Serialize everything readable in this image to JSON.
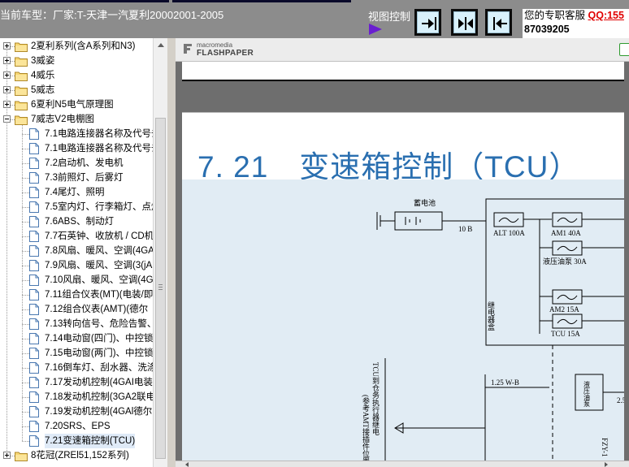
{
  "header": {
    "current_car": "当前车型：厂家:T-天津一汽夏利20002001-2005",
    "view_control_label": "视图控制",
    "support_label": "您的专职客服",
    "qq_label": "QQ:155",
    "phone_partial": "87039205"
  },
  "tree": {
    "items": [
      {
        "label": "2夏利系列(含A系列和N3)",
        "type": "folder",
        "expanded": false
      },
      {
        "label": "3威姿",
        "type": "folder",
        "expanded": false
      },
      {
        "label": "4威乐",
        "type": "folder",
        "expanded": false
      },
      {
        "label": "5威志",
        "type": "folder",
        "expanded": false
      },
      {
        "label": "6夏利N5电气原理图",
        "type": "folder",
        "expanded": false
      },
      {
        "label": "7威志V2电棚图",
        "type": "folder",
        "expanded": true
      },
      {
        "label": "7.1电路连接器名称及代号去",
        "type": "doc"
      },
      {
        "label": "7.1电路连接器名称及代号去",
        "type": "doc"
      },
      {
        "label": "7.2启动机、发电机",
        "type": "doc"
      },
      {
        "label": "7.3前照灯、后雾灯",
        "type": "doc"
      },
      {
        "label": "7.4尾灯、照明",
        "type": "doc"
      },
      {
        "label": "7.5室内灯、行李箱灯、点烟",
        "type": "doc"
      },
      {
        "label": "7.6ABS、制动灯",
        "type": "doc"
      },
      {
        "label": "7.7石英钟、收放机 / CD机",
        "type": "doc"
      },
      {
        "label": "7.8风扇、暖风、空调(4GA",
        "type": "doc"
      },
      {
        "label": "7.9风扇、暖风、空调(3(jA",
        "type": "doc"
      },
      {
        "label": "7.10风扇、暖风、空调(4G",
        "type": "doc"
      },
      {
        "label": "7.11组合仪表(MT)(电装/即",
        "type": "doc"
      },
      {
        "label": "7.12组合仪表(AMT)(德尔",
        "type": "doc"
      },
      {
        "label": "7.13转向信号、危险告警、",
        "type": "doc"
      },
      {
        "label": "7.14电动窗(四门)、中控锁",
        "type": "doc"
      },
      {
        "label": "7.15电动窗(两门)、中控锁",
        "type": "doc"
      },
      {
        "label": "7.16倒车灯、刮水器、洗涤",
        "type": "doc"
      },
      {
        "label": "7.17发动机控制(4GAI电装",
        "type": "doc"
      },
      {
        "label": "7.18发动机控制(3GA2联电",
        "type": "doc"
      },
      {
        "label": "7.19发动机控制(4GAl德尔",
        "type": "doc"
      },
      {
        "label": "7.20SRS、EPS",
        "type": "doc"
      },
      {
        "label": "7.21变速箱控制(TCU)",
        "type": "doc",
        "selected": true
      },
      {
        "label": "8花冠(ZREl51,152系列)",
        "type": "folder",
        "expanded": false
      }
    ]
  },
  "viewer": {
    "logo_small": "macromedia",
    "logo_big": "FLASHPAPER",
    "page_title": "7. 21　变速箱控制（TCU）",
    "diagram": {
      "battery_label": "蓄电池",
      "wire_10b": "10 B",
      "fuse_alt": "ALT 100A",
      "fuse_am1": "AM1 40A",
      "fuse_pump": "液压油泵 30A",
      "fuse_am2": "AM2 15A",
      "fuse_tcu": "TCU 15A",
      "relay_box": "继电器盒",
      "wire_125wb": "1.25 W-B",
      "pump_box": "液压油泵",
      "tcu_note": "TCU到仓务执行器继电",
      "amt_note": "(参考AMT接插件位置",
      "fzy_label": "FZY-1",
      "wire_25": "2.5"
    }
  },
  "colors": {
    "topbar": "#8c8c8c",
    "title_blue": "#2a6fb0",
    "diagram_bg": "#e1ecf4",
    "qq_red": "#e00000",
    "arrow_purple": "#6a1fd0"
  }
}
